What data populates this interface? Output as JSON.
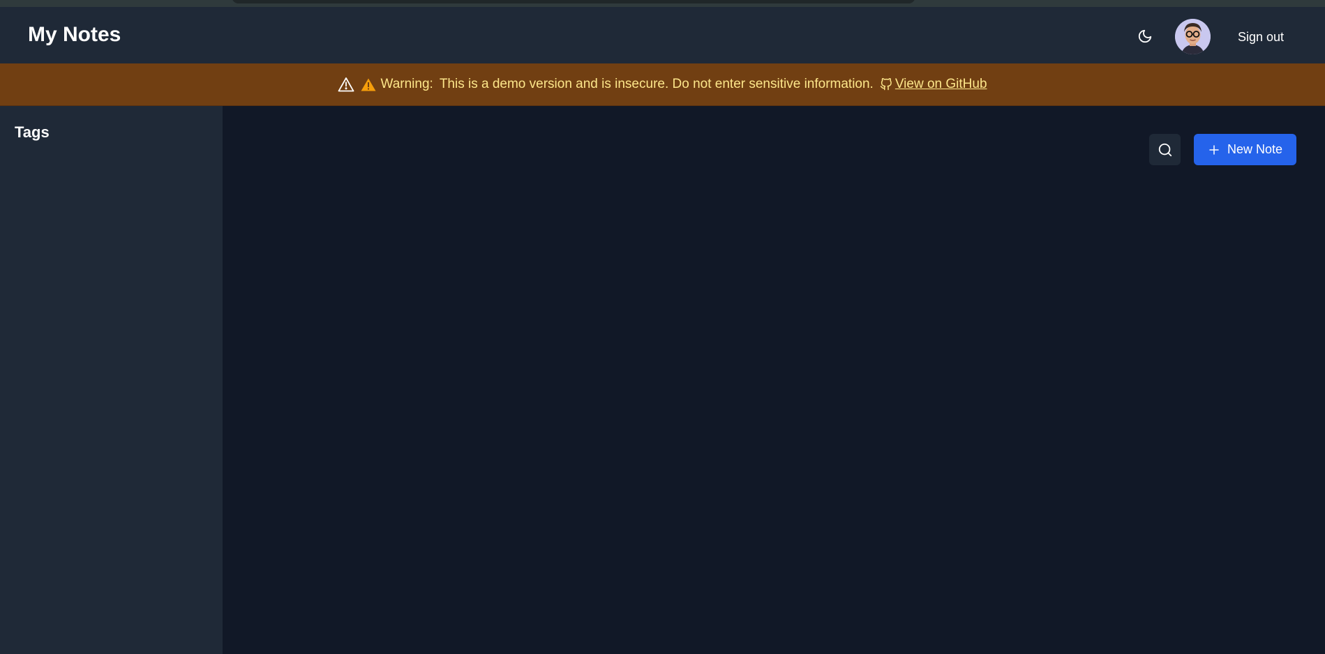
{
  "header": {
    "title": "My Notes",
    "signout_label": "Sign out"
  },
  "banner": {
    "warning_label": "Warning:",
    "message": "This is a demo version and is insecure. Do not enter sensitive information.",
    "github_link": "View on GitHub"
  },
  "sidebar": {
    "title": "Tags"
  },
  "toolbar": {
    "new_note_label": "New Note"
  },
  "icons": {
    "theme": "moon-icon",
    "search": "search-icon",
    "add": "plus-icon",
    "warning": "warning-icon",
    "github": "github-icon"
  },
  "colors": {
    "header_bg": "#1f2937",
    "main_bg": "#111827",
    "banner_bg": "#713f12",
    "banner_text": "#fde68a",
    "accent": "#2563eb"
  }
}
